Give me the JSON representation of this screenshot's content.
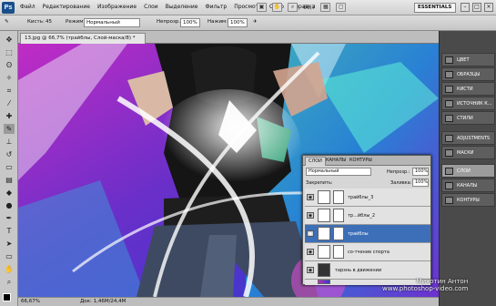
{
  "app": {
    "logo": "Ps",
    "zoom": "66,7",
    "workspace": "ESSENTIALS"
  },
  "menu": [
    "Файл",
    "Редактирование",
    "Изображение",
    "Слои",
    "Выделение",
    "Фильтр",
    "Просмотр",
    "Окно",
    "Справка"
  ],
  "options": {
    "brush_label": "Кисть:",
    "brush_size": "45",
    "mode_label": "Режим:",
    "mode_value": "Нормальный",
    "opacity_label": "Непрозр.:",
    "opacity_value": "100%",
    "flow_label": "Нажим:",
    "flow_value": "100%"
  },
  "document": {
    "tab_title": "13.jpg @ 66,7% (трайблы, Слой-маска/8) *",
    "status_zoom": "66,67%",
    "status_doc": "Док: 1,46М/24,4М"
  },
  "dock": [
    {
      "label": "ЦВЕТ",
      "icon": "color-icon"
    },
    {
      "label": "ОБРАЗЦЫ",
      "icon": "swatches-icon"
    },
    {
      "label": "КИСТИ",
      "icon": "brushes-icon"
    },
    {
      "label": "ИСТОЧНИК К...",
      "icon": "clone-source-icon"
    },
    {
      "label": "СТИЛИ",
      "icon": "styles-icon"
    },
    {
      "label": "ADJUSTMENTS",
      "icon": "adjustments-icon"
    },
    {
      "label": "МАСКИ",
      "icon": "masks-icon"
    },
    {
      "label": "СЛОИ",
      "icon": "layers-icon"
    },
    {
      "label": "КАНАЛЫ",
      "icon": "channels-icon"
    },
    {
      "label": "КОНТУРЫ",
      "icon": "paths-icon"
    }
  ],
  "layers_panel": {
    "tabs": [
      "СЛОИ",
      "КАНАЛЫ",
      "КОНТУРЫ"
    ],
    "blend_mode": "Нормальный",
    "opacity_label": "Непрозр.:",
    "opacity_value": "100%",
    "lock_label": "Закрепить:",
    "fill_label": "Заливка:",
    "fill_value": "100%",
    "layers": [
      {
        "name": "трайблы_3",
        "selected": false
      },
      {
        "name": "тр...йблы_2",
        "selected": false
      },
      {
        "name": "трайблы",
        "selected": true
      },
      {
        "name": "со-тчение спорта",
        "selected": false
      },
      {
        "name": "тарзнь в движении",
        "selected": false
      },
      {
        "name": "",
        "selected": false
      }
    ]
  },
  "watermark": {
    "line1": "Михотин Антон",
    "line2": "www.photoshop-video.com"
  }
}
